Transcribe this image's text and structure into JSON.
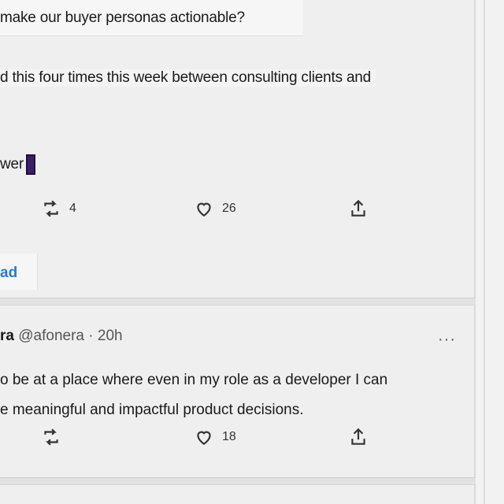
{
  "tweet1": {
    "lines": [
      "make our buyer personas actionable?",
      "d this four times this week between consulting clients and",
      "wer"
    ],
    "retweets": "4",
    "likes": "26",
    "show_thread": "ad"
  },
  "tweet2": {
    "name": "ra",
    "handle": "@afonera",
    "time": "· 20h",
    "more": "···",
    "body": [
      "o be at a place where even in my role as a developer I can",
      "e meaningful and impactful product decisions."
    ],
    "retweets": "",
    "likes": "18"
  },
  "icons": {
    "retweet": "retweet-icon",
    "like": "heart-icon",
    "share": "share-icon",
    "more": "more-icon"
  }
}
